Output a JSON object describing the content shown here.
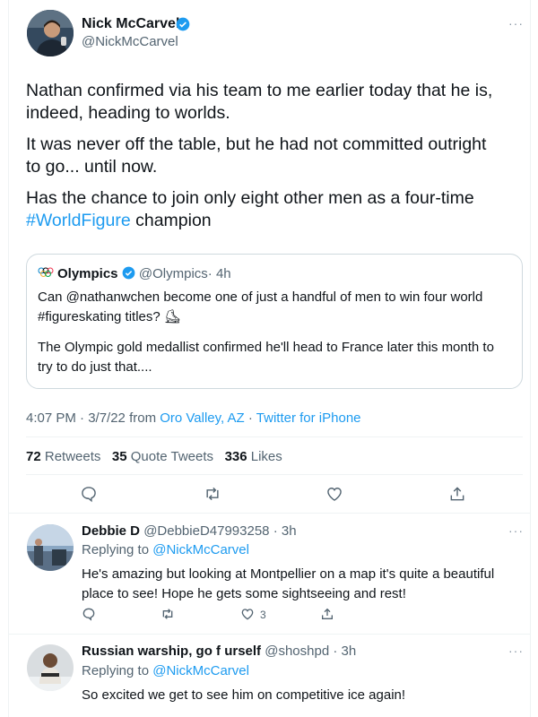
{
  "main_tweet": {
    "author_name": "Nick McCarvel",
    "handle": "@NickMcCarvel",
    "paragraph1": "Nathan confirmed via his team to me earlier today that he is,",
    "paragraph1b": "indeed, heading to worlds.",
    "paragraph2": "It was never off the table, but he had not committed outright",
    "paragraph2b": "to go... until now.",
    "paragraph3": "Has the chance to join only eight other men as a four-time",
    "hashtag": "#WorldFigure",
    "paragraph3_tail": " champion",
    "more": "···"
  },
  "quoted_tweet": {
    "author_name": "Olympics",
    "handle": "@Olympics",
    "time": "· 4h",
    "line1": "Can @nathanwchen become one of just a handful of men to win four world",
    "line2": "#figureskating titles? ⛸",
    "line3": "The Olympic gold medallist confirmed he'll head to France later this month to",
    "line4": "try to do just that...."
  },
  "meta": {
    "time": "4:07 PM · 3/7/22 from ",
    "location": "Oro Valley, AZ",
    "sep": " · ",
    "client": "Twitter for iPhone"
  },
  "stats": {
    "retweets_count": "72",
    "retweets_label": " Retweets",
    "quotes_count": "35",
    "quotes_label": " Quote Tweets",
    "likes_count": "336",
    "likes_label": " Likes"
  },
  "replies": [
    {
      "author_name": "Debbie D",
      "handle": "@DebbieD47993258",
      "time": "· 3h",
      "replying_label": "Replying to ",
      "replying_to": "@NickMcCarvel",
      "line1": "He's amazing but looking at Montpellier on a map it's quite a beautiful",
      "line2": "place to see! Hope he gets some sightseeing and rest!",
      "like_count": "3"
    },
    {
      "author_name": "Russian warship, go f urself",
      "handle": "@shoshpd",
      "time": "· 3h",
      "replying_label": "Replying to ",
      "replying_to": "@NickMcCarvel",
      "line1": "So excited we get to see him on competitive ice again!"
    }
  ],
  "colors": {
    "accent": "#1d9bf0",
    "muted": "#536471",
    "border": "#eff3f4",
    "verified": "#1d9bf0"
  }
}
